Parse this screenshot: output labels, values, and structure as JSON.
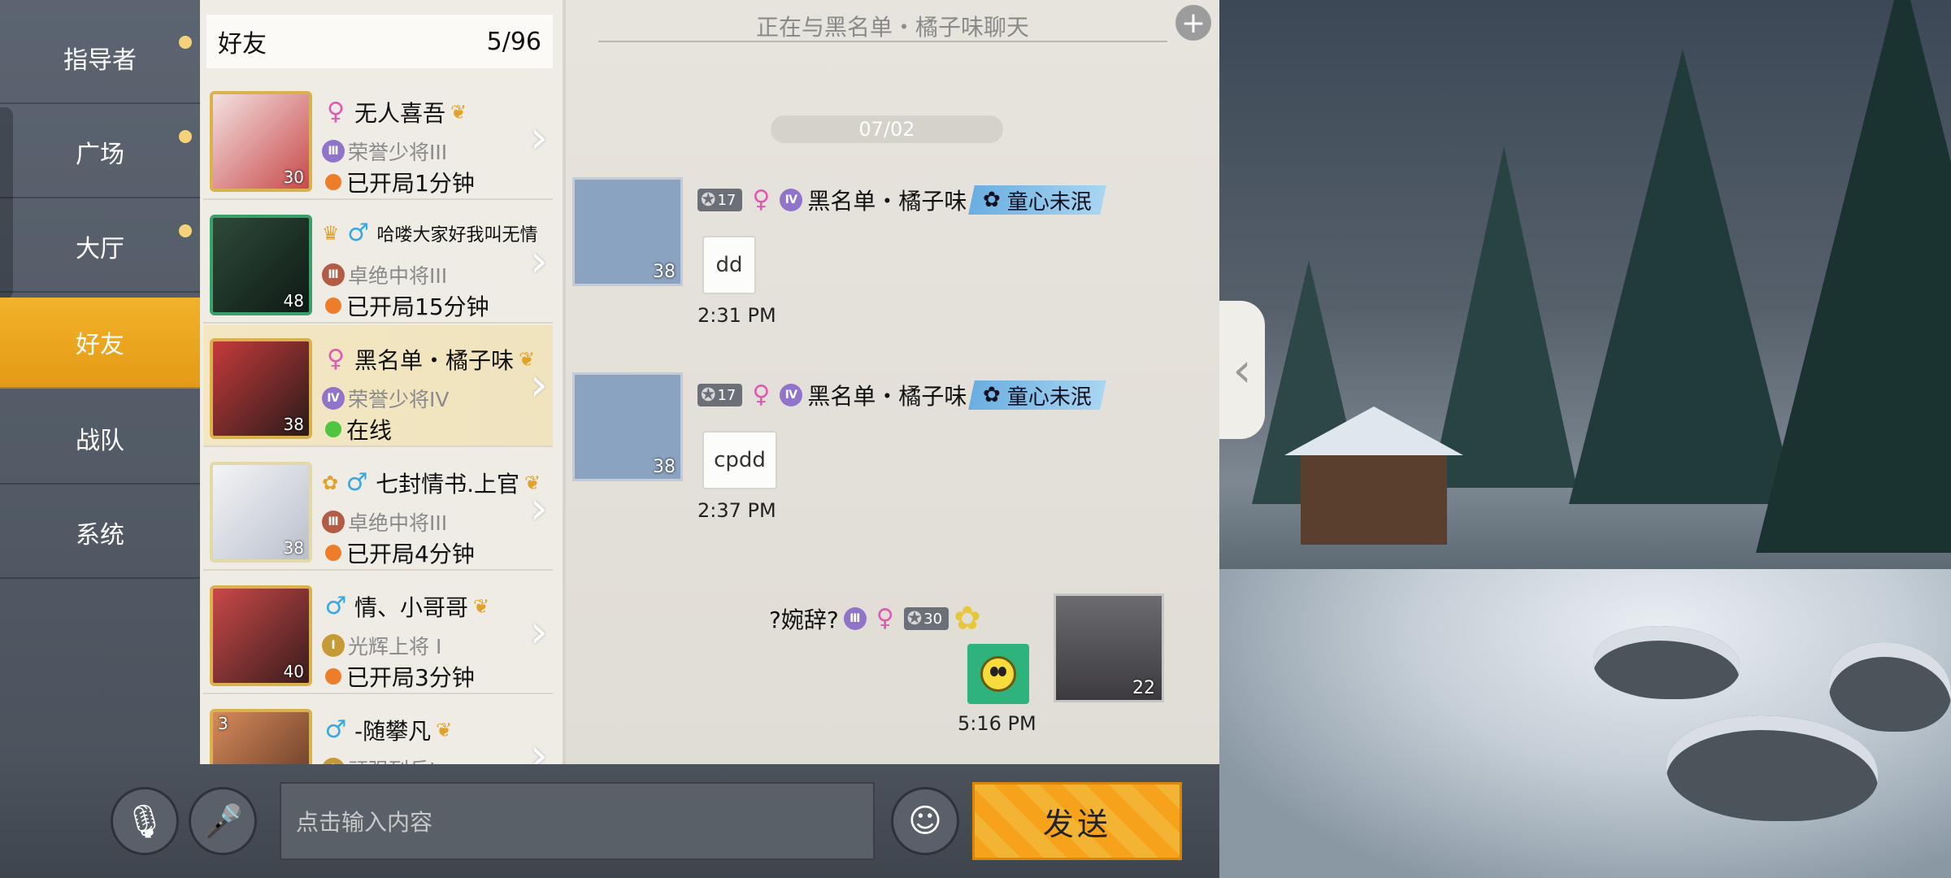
{
  "nav": {
    "items": [
      {
        "label": "指导者",
        "dot": true
      },
      {
        "label": "广场",
        "dot": true
      },
      {
        "label": "大厅",
        "dot": true
      },
      {
        "label": "好友",
        "dot": false,
        "active": true
      },
      {
        "label": "战队",
        "dot": false
      },
      {
        "label": "系统",
        "dot": false
      }
    ]
  },
  "friends": {
    "title": "好友",
    "count": "5/96",
    "rows": [
      {
        "name": "无人喜吾",
        "gender": "female",
        "rank": "荣誉少将III",
        "status": "已开局1分钟",
        "status_color": "orange",
        "level": "30"
      },
      {
        "name": "哈喽大家好我叫无情",
        "gender": "male",
        "rank": "卓绝中将III",
        "status": "已开局15分钟",
        "status_color": "orange",
        "level": "48"
      },
      {
        "name": "黑名单・橘子味",
        "gender": "female",
        "rank": "荣誉少将IV",
        "status": "在线",
        "status_color": "green",
        "level": "38",
        "selected": true
      },
      {
        "name": "七封情书.上官",
        "gender": "male",
        "rank": "卓绝中将III",
        "status": "已开局4分钟",
        "status_color": "orange",
        "level": "38"
      },
      {
        "name": "情、小哥哥",
        "gender": "male",
        "rank": "光辉上将 I",
        "status": "已开局3分钟",
        "status_color": "orange",
        "level": "40"
      },
      {
        "name": "-随攀凡",
        "gender": "male",
        "rank": "顽强列兵I",
        "status": "",
        "status_color": "orange",
        "level": "3"
      }
    ]
  },
  "chat": {
    "title": "正在与黑名单・橘子味聊天",
    "date": "07/02",
    "messages": [
      {
        "sender": "黑名单・橘子味",
        "level_badge": "17",
        "title_tag": "童心未泯",
        "avatar_level": "38",
        "text": "dd",
        "time": "2:31 PM"
      },
      {
        "sender": "黑名单・橘子味",
        "level_badge": "17",
        "title_tag": "童心未泯",
        "avatar_level": "38",
        "text": "cpdd",
        "time": "2:37 PM"
      }
    ],
    "self": {
      "name": "?婉辞?",
      "level_badge": "30",
      "avatar_level": "22",
      "time": "5:16 PM"
    }
  },
  "input": {
    "placeholder": "点击输入内容",
    "send_label": "发送"
  },
  "colors": {
    "accent": "#f2a31c",
    "online": "#4fc640",
    "in_game": "#ec7e2a",
    "female": "#e259b5",
    "male": "#3aa7e0"
  }
}
